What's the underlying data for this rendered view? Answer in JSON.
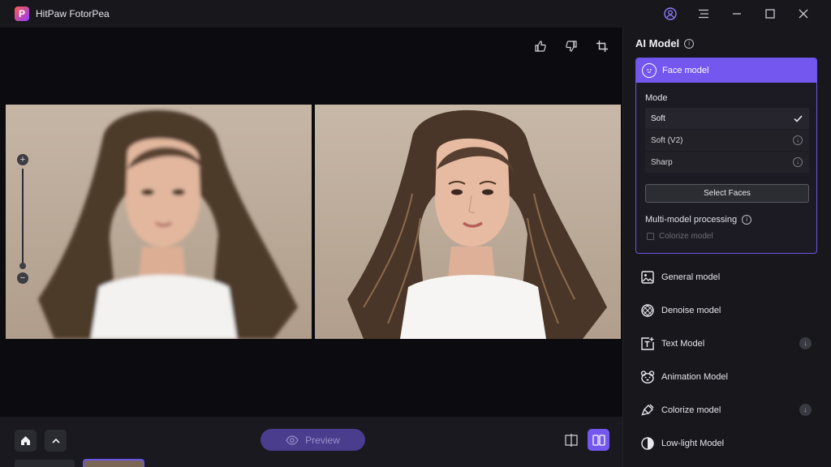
{
  "app": {
    "title": "HitPaw FotorPea",
    "logo_letter": "P"
  },
  "window_controls": [
    "account-icon",
    "menu-icon",
    "minimize-icon",
    "maximize-icon",
    "close-icon"
  ],
  "canvas": {
    "toolbar": [
      "thumbs-up-icon",
      "thumbs-down-icon",
      "crop-icon"
    ],
    "zoom": {
      "in": "+",
      "out": "−"
    }
  },
  "bottom_bar": {
    "preview_label": "Preview",
    "view_modes": [
      "split-view-icon",
      "side-by-side-icon"
    ],
    "active_view": "side-by-side"
  },
  "sidebar": {
    "title": "AI Model",
    "face_model": {
      "label": "Face model",
      "mode_label": "Mode",
      "modes": [
        {
          "label": "Soft",
          "state": "selected"
        },
        {
          "label": "Soft (V2)",
          "state": "download"
        },
        {
          "label": "Sharp",
          "state": "download"
        }
      ],
      "select_faces": "Select Faces",
      "multi_model": "Multi-model processing",
      "colorize_option": "Colorize model"
    },
    "models": [
      {
        "label": "General model",
        "icon": "image-icon",
        "download": false
      },
      {
        "label": "Denoise model",
        "icon": "denoise-icon",
        "download": false
      },
      {
        "label": "Text Model",
        "icon": "text-icon",
        "download": true
      },
      {
        "label": "Animation Model",
        "icon": "bear-icon",
        "download": false
      },
      {
        "label": "Colorize model",
        "icon": "brush-icon",
        "download": true
      },
      {
        "label": "Low-light Model",
        "icon": "contrast-icon",
        "download": false
      }
    ]
  },
  "colors": {
    "accent": "#7357ee",
    "background": "#0c0c10",
    "panel": "#17171c"
  }
}
